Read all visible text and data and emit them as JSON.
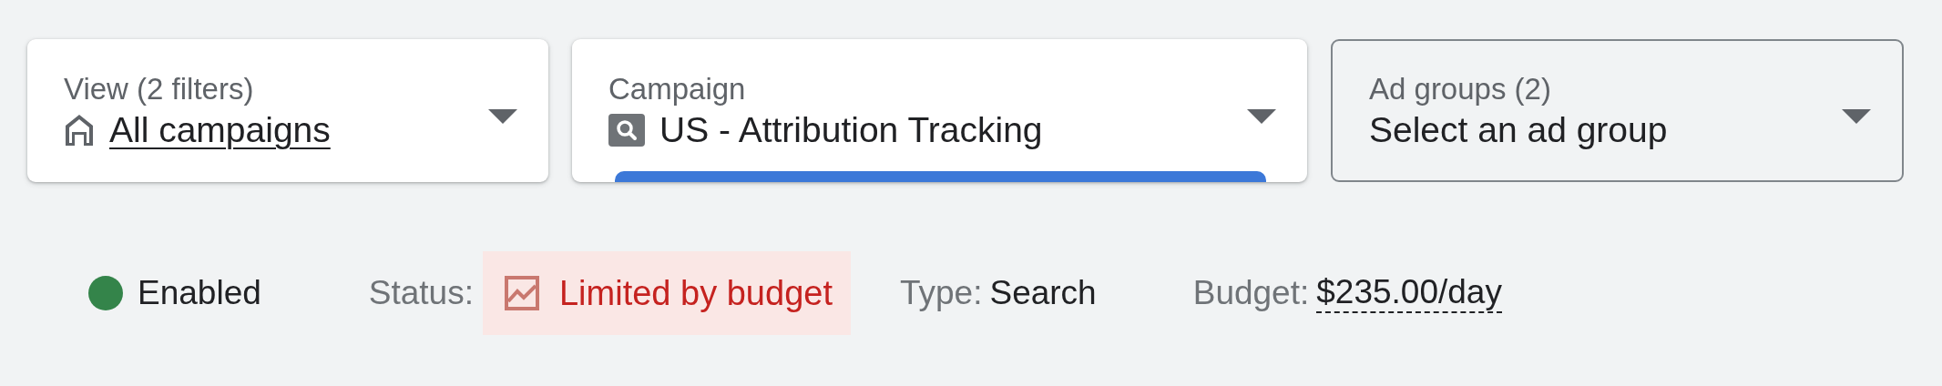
{
  "filters": [
    {
      "kind": "elevated",
      "label": "View (2 filters)",
      "value": "All campaigns"
    },
    {
      "kind": "elevated",
      "label": "Campaign",
      "value": "US - Attribution Tracking"
    },
    {
      "kind": "outlined",
      "label": "Ad groups (2)",
      "value": "Select an ad group"
    }
  ],
  "summary": {
    "state": "Enabled",
    "color": "#34844a",
    "status_label": "Status:",
    "status": "Limited by budget",
    "type_label": "Type:",
    "type": "Search",
    "budget_label": "Budget:",
    "budget": "$235.00/day"
  }
}
